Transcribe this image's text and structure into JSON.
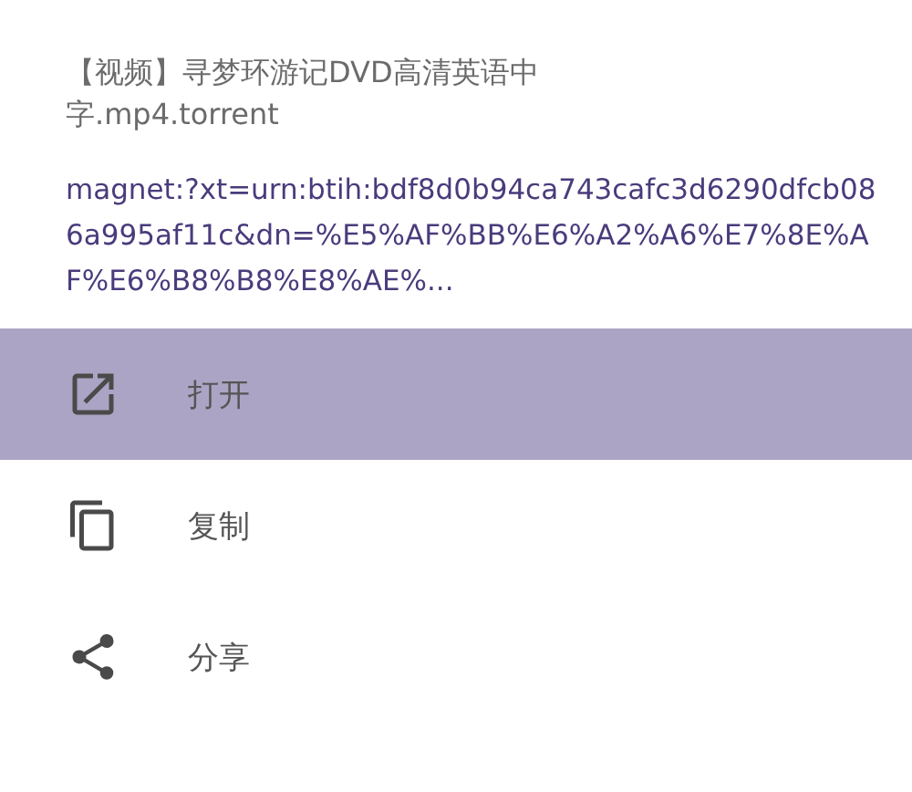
{
  "title": "【视频】寻梦环游记DVD高清英语中字.mp4.torrent",
  "link": "magnet:?xt=urn:btih:bdf8d0b94ca743cafc3d6290dfcb086a995af11c&dn=%E5%AF%BB%E6%A2%A6%E7%8E%AF%E6%B8%B8%E8%AE%...",
  "menu": [
    {
      "kind": "open",
      "label": "打开",
      "selected": true
    },
    {
      "kind": "copy",
      "label": "复制",
      "selected": false
    },
    {
      "kind": "share",
      "label": "分享",
      "selected": false
    }
  ]
}
